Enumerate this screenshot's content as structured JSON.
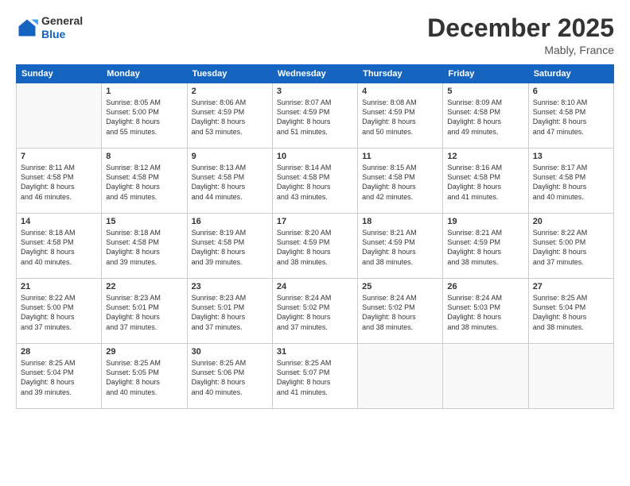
{
  "header": {
    "logo_line1": "General",
    "logo_line2": "Blue",
    "month": "December 2025",
    "location": "Mably, France"
  },
  "weekdays": [
    "Sunday",
    "Monday",
    "Tuesday",
    "Wednesday",
    "Thursday",
    "Friday",
    "Saturday"
  ],
  "weeks": [
    [
      {
        "day": "",
        "sunrise": "",
        "sunset": "",
        "daylight": ""
      },
      {
        "day": "1",
        "sunrise": "8:05 AM",
        "sunset": "5:00 PM",
        "daylight": "8 hours and 55 minutes."
      },
      {
        "day": "2",
        "sunrise": "8:06 AM",
        "sunset": "4:59 PM",
        "daylight": "8 hours and 53 minutes."
      },
      {
        "day": "3",
        "sunrise": "8:07 AM",
        "sunset": "4:59 PM",
        "daylight": "8 hours and 51 minutes."
      },
      {
        "day": "4",
        "sunrise": "8:08 AM",
        "sunset": "4:59 PM",
        "daylight": "8 hours and 50 minutes."
      },
      {
        "day": "5",
        "sunrise": "8:09 AM",
        "sunset": "4:58 PM",
        "daylight": "8 hours and 49 minutes."
      },
      {
        "day": "6",
        "sunrise": "8:10 AM",
        "sunset": "4:58 PM",
        "daylight": "8 hours and 47 minutes."
      }
    ],
    [
      {
        "day": "7",
        "sunrise": "8:11 AM",
        "sunset": "4:58 PM",
        "daylight": "8 hours and 46 minutes."
      },
      {
        "day": "8",
        "sunrise": "8:12 AM",
        "sunset": "4:58 PM",
        "daylight": "8 hours and 45 minutes."
      },
      {
        "day": "9",
        "sunrise": "8:13 AM",
        "sunset": "4:58 PM",
        "daylight": "8 hours and 44 minutes."
      },
      {
        "day": "10",
        "sunrise": "8:14 AM",
        "sunset": "4:58 PM",
        "daylight": "8 hours and 43 minutes."
      },
      {
        "day": "11",
        "sunrise": "8:15 AM",
        "sunset": "4:58 PM",
        "daylight": "8 hours and 42 minutes."
      },
      {
        "day": "12",
        "sunrise": "8:16 AM",
        "sunset": "4:58 PM",
        "daylight": "8 hours and 41 minutes."
      },
      {
        "day": "13",
        "sunrise": "8:17 AM",
        "sunset": "4:58 PM",
        "daylight": "8 hours and 40 minutes."
      }
    ],
    [
      {
        "day": "14",
        "sunrise": "8:18 AM",
        "sunset": "4:58 PM",
        "daylight": "8 hours and 40 minutes."
      },
      {
        "day": "15",
        "sunrise": "8:18 AM",
        "sunset": "4:58 PM",
        "daylight": "8 hours and 39 minutes."
      },
      {
        "day": "16",
        "sunrise": "8:19 AM",
        "sunset": "4:58 PM",
        "daylight": "8 hours and 39 minutes."
      },
      {
        "day": "17",
        "sunrise": "8:20 AM",
        "sunset": "4:59 PM",
        "daylight": "8 hours and 38 minutes."
      },
      {
        "day": "18",
        "sunrise": "8:21 AM",
        "sunset": "4:59 PM",
        "daylight": "8 hours and 38 minutes."
      },
      {
        "day": "19",
        "sunrise": "8:21 AM",
        "sunset": "4:59 PM",
        "daylight": "8 hours and 38 minutes."
      },
      {
        "day": "20",
        "sunrise": "8:22 AM",
        "sunset": "5:00 PM",
        "daylight": "8 hours and 37 minutes."
      }
    ],
    [
      {
        "day": "21",
        "sunrise": "8:22 AM",
        "sunset": "5:00 PM",
        "daylight": "8 hours and 37 minutes."
      },
      {
        "day": "22",
        "sunrise": "8:23 AM",
        "sunset": "5:01 PM",
        "daylight": "8 hours and 37 minutes."
      },
      {
        "day": "23",
        "sunrise": "8:23 AM",
        "sunset": "5:01 PM",
        "daylight": "8 hours and 37 minutes."
      },
      {
        "day": "24",
        "sunrise": "8:24 AM",
        "sunset": "5:02 PM",
        "daylight": "8 hours and 37 minutes."
      },
      {
        "day": "25",
        "sunrise": "8:24 AM",
        "sunset": "5:02 PM",
        "daylight": "8 hours and 38 minutes."
      },
      {
        "day": "26",
        "sunrise": "8:24 AM",
        "sunset": "5:03 PM",
        "daylight": "8 hours and 38 minutes."
      },
      {
        "day": "27",
        "sunrise": "8:25 AM",
        "sunset": "5:04 PM",
        "daylight": "8 hours and 38 minutes."
      }
    ],
    [
      {
        "day": "28",
        "sunrise": "8:25 AM",
        "sunset": "5:04 PM",
        "daylight": "8 hours and 39 minutes."
      },
      {
        "day": "29",
        "sunrise": "8:25 AM",
        "sunset": "5:05 PM",
        "daylight": "8 hours and 40 minutes."
      },
      {
        "day": "30",
        "sunrise": "8:25 AM",
        "sunset": "5:06 PM",
        "daylight": "8 hours and 40 minutes."
      },
      {
        "day": "31",
        "sunrise": "8:25 AM",
        "sunset": "5:07 PM",
        "daylight": "8 hours and 41 minutes."
      },
      {
        "day": "",
        "sunrise": "",
        "sunset": "",
        "daylight": ""
      },
      {
        "day": "",
        "sunrise": "",
        "sunset": "",
        "daylight": ""
      },
      {
        "day": "",
        "sunrise": "",
        "sunset": "",
        "daylight": ""
      }
    ]
  ]
}
